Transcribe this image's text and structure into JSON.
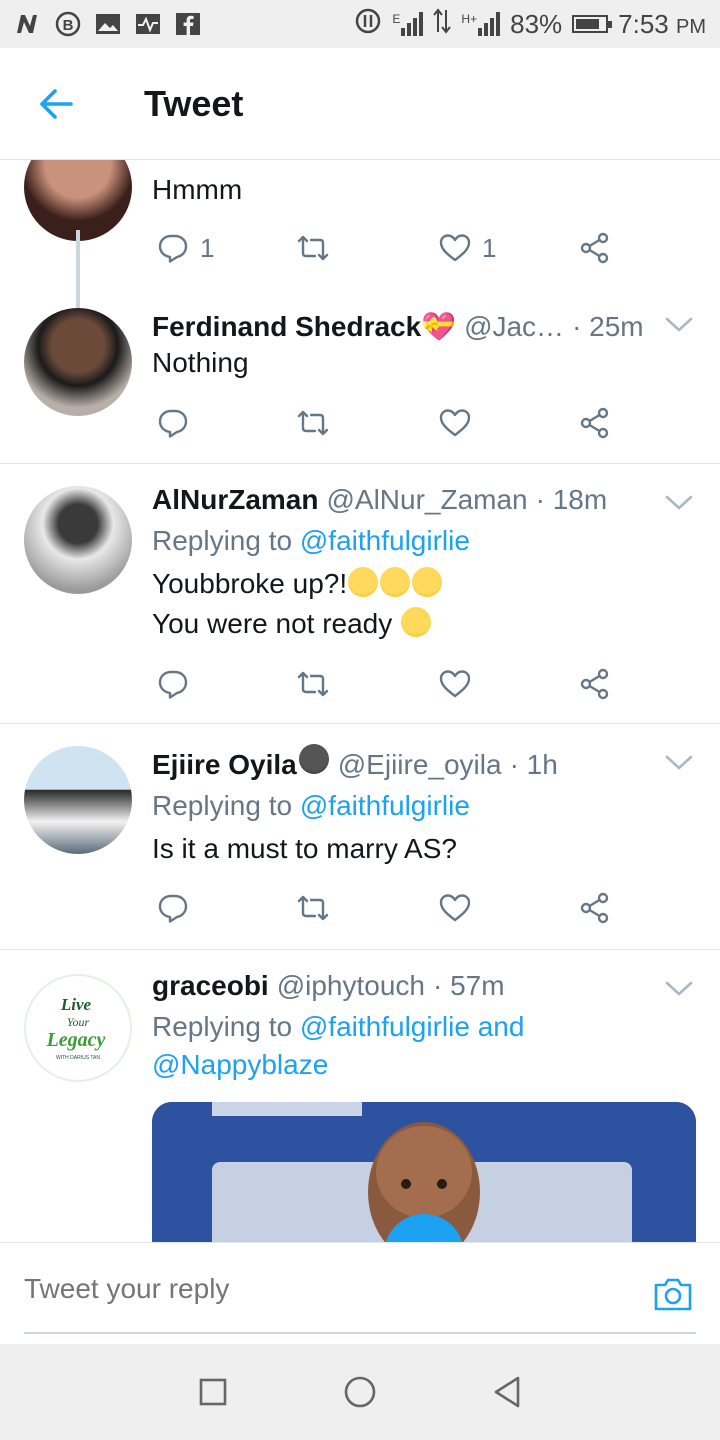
{
  "status_bar": {
    "left_icons": [
      "n-icon",
      "b-circle-icon",
      "image-icon",
      "activity-icon",
      "facebook-icon"
    ],
    "network_e": "E",
    "network_h": "H+",
    "battery_percent": "83%",
    "battery_level": 0.83,
    "time": "7:53",
    "ampm": "PM"
  },
  "header": {
    "title": "Tweet"
  },
  "tweets": [
    {
      "text": "Hmmm",
      "reply_count": "1",
      "like_count": "1"
    },
    {
      "name": "Ferdinand Shedrack💝",
      "handle": "@Jac…",
      "time": "· 25m",
      "text": "Nothing"
    },
    {
      "name": "AlNurZaman",
      "handle": "@AlNur_Zaman",
      "time": "· 18m",
      "replying_prefix": "Replying to ",
      "replying_to": "@faithfulgirlie",
      "text_line1": "Youbbroke up?!",
      "text_line2": "You were not ready "
    },
    {
      "name": "Ejiire Oyila",
      "handle": "@Ejiire_oyila",
      "time": "· 1h",
      "replying_prefix": "Replying to ",
      "replying_to": "@faithfulgirlie",
      "text": "Is it a must to marry AS?"
    },
    {
      "name": "graceobi",
      "handle": "@iphytouch",
      "time": "· 57m",
      "replying_prefix": "Replying to ",
      "replying_to": "@faithfulgirlie and",
      "replying_to_2": "@Nappyblaze",
      "avatar_line1": "Live",
      "avatar_line2": "Your",
      "avatar_line3": "Legacy",
      "avatar_line4": "WITH DARIUS TAN"
    }
  ],
  "reply_bar": {
    "placeholder": "Tweet your reply"
  },
  "colors": {
    "accent": "#1da1f2",
    "muted": "#657786",
    "text": "#14171a"
  }
}
